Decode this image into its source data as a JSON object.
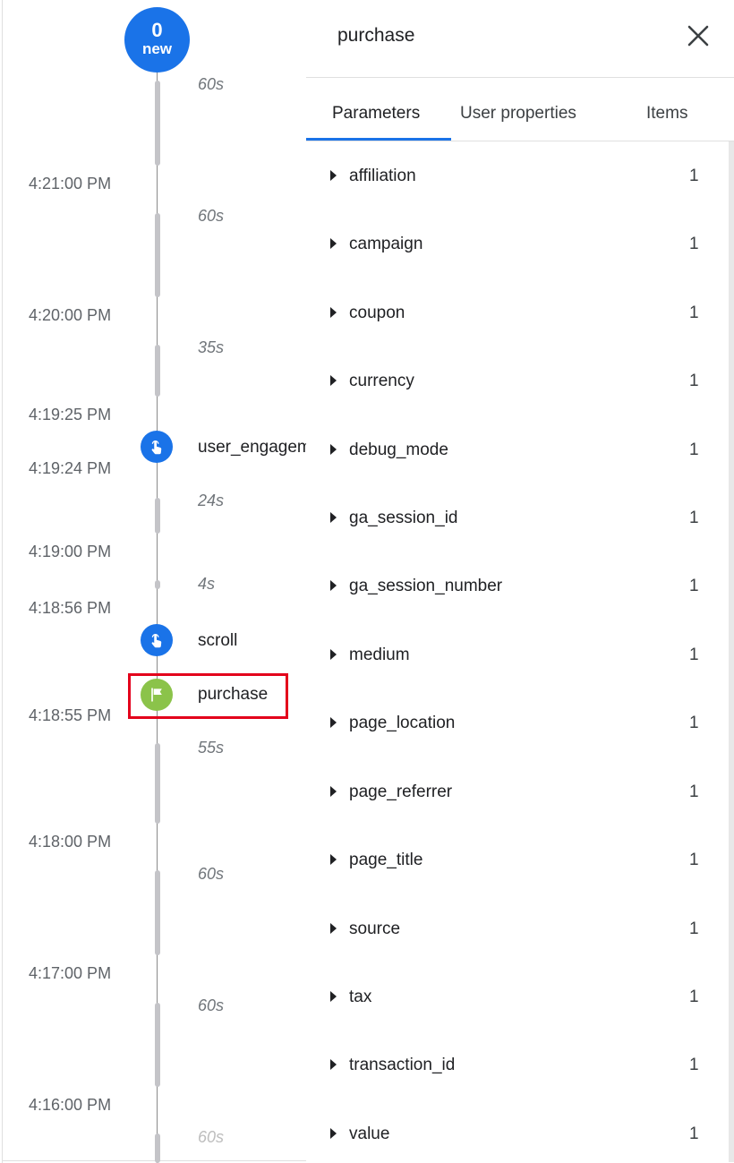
{
  "timeline": {
    "new_badge": {
      "count": "0",
      "label": "new"
    },
    "timestamps": [
      "4:21:00 PM",
      "4:20:00 PM",
      "4:19:25 PM",
      "4:19:24 PM",
      "4:19:00 PM",
      "4:18:56 PM",
      "4:18:55 PM",
      "4:18:00 PM",
      "4:17:00 PM",
      "4:16:00 PM"
    ],
    "durations": [
      "60s",
      "60s",
      "35s",
      "24s",
      "4s",
      "55s",
      "60s",
      "60s",
      "60s"
    ],
    "events": [
      {
        "name": "user_engagement",
        "icon": "touch-icon",
        "color": "#1a73e8"
      },
      {
        "name": "scroll",
        "icon": "touch-icon",
        "color": "#1a73e8"
      },
      {
        "name": "purchase",
        "icon": "flag-icon",
        "color": "#8bc34a",
        "highlighted": true
      }
    ]
  },
  "panel": {
    "title": "purchase",
    "close_icon": "close-icon",
    "tabs": [
      {
        "label": "Parameters",
        "active": true
      },
      {
        "label": "User properties",
        "active": false
      },
      {
        "label": "Items",
        "active": false
      }
    ],
    "parameters": [
      {
        "name": "affiliation",
        "count": "1"
      },
      {
        "name": "campaign",
        "count": "1"
      },
      {
        "name": "coupon",
        "count": "1"
      },
      {
        "name": "currency",
        "count": "1"
      },
      {
        "name": "debug_mode",
        "count": "1"
      },
      {
        "name": "ga_session_id",
        "count": "1"
      },
      {
        "name": "ga_session_number",
        "count": "1"
      },
      {
        "name": "medium",
        "count": "1"
      },
      {
        "name": "page_location",
        "count": "1"
      },
      {
        "name": "page_referrer",
        "count": "1"
      },
      {
        "name": "page_title",
        "count": "1"
      },
      {
        "name": "source",
        "count": "1"
      },
      {
        "name": "tax",
        "count": "1"
      },
      {
        "name": "transaction_id",
        "count": "1"
      },
      {
        "name": "value",
        "count": "1"
      }
    ]
  },
  "colors": {
    "accent": "#1a73e8",
    "event_green": "#8bc34a",
    "highlight_red": "#e3001b"
  }
}
